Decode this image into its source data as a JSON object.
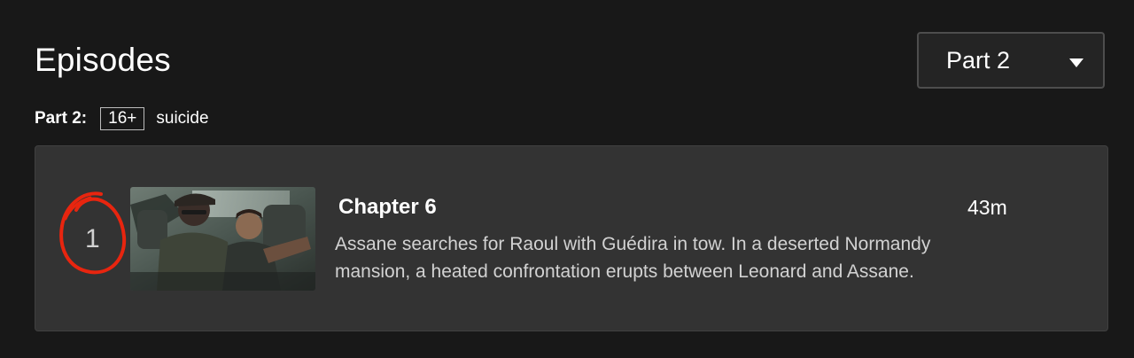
{
  "header": {
    "title": "Episodes",
    "season_selector": {
      "selected": "Part 2",
      "icon": "caret-down-icon"
    }
  },
  "maturity": {
    "part_label": "Part 2:",
    "rating": "16+",
    "advisory": "suicide"
  },
  "episodes": [
    {
      "index": "1",
      "title": "Chapter 6",
      "duration": "43m",
      "synopsis": "Assane searches for Raoul with Guédira in tow. In a deserted Normandy mansion, a heated confrontation erupts between Leonard and Assane."
    }
  ],
  "annotation": {
    "color": "#e8250f",
    "shape": "hand-drawn circle around episode number"
  },
  "colors": {
    "background": "#181818",
    "card": "#333333",
    "selector": "#242424",
    "text": "#ffffff",
    "muted_text": "#d2d2d2"
  }
}
